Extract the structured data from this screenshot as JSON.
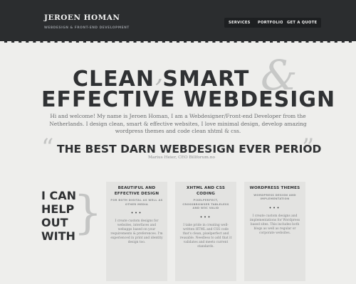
{
  "header": {
    "brand": "JEROEN HOMAN",
    "tagline": "WEBDESIGN & FRONT-END DEVELOPMENT",
    "nav": [
      "SERVICES",
      "PORTFOLIO",
      "GET A QUOTE"
    ]
  },
  "hero": {
    "line1": "CLEAN  SMART",
    "comma": ",",
    "amp": "&",
    "line2": "EFFECTIVE WEBDESIGN",
    "intro": "Hi and welcome! My name is Jeroen Homan, I am a Webdesigner/Front-end Developer from the Netherlands. I design clean, smart & effective websites, I love minimal design, develop amazing wordpress themes and code clean xhtml & css."
  },
  "quote": {
    "open_mark": "“",
    "close_mark": "”",
    "text": "THE BEST DARN WEBDESIGN EVER PERIOD",
    "author": "Marius Heier, CEO Billforum.no"
  },
  "services": {
    "heading_lines": [
      "I CAN",
      "HELP",
      "OUT",
      "WITH"
    ],
    "brace": "}",
    "cards": [
      {
        "title": "BEAUTIFUL AND EFFECTIVE DESIGN",
        "subtitle": "FOR BOTH DIGITAL AS WELL AS OTHER MEDIA",
        "dots": "•••",
        "text": "I create custom designs for websites, interfaces and webapps based on your requirements & preferences. I'm experienced in print and identity design too."
      },
      {
        "title": "XHTML AND CSS CODING",
        "subtitle": "PIXELPERFECT, CROSSBROWSER TABLELESS AND W3C VALID",
        "dots": "•••",
        "text": "I take pride in creating well-written HTML and CSS code that's clean, pixelperfect and reusable. Needless to add that it validates and meets current standards."
      },
      {
        "title": "WORDPRESS THEMES",
        "subtitle": "WORDPRESS DESIGN AND IMPLEMENTATION",
        "dots": "•••",
        "text": "I create custom designs and implementations for Wordpress based sites. This includes both blogs as well as regular or corporate websites."
      }
    ]
  }
}
